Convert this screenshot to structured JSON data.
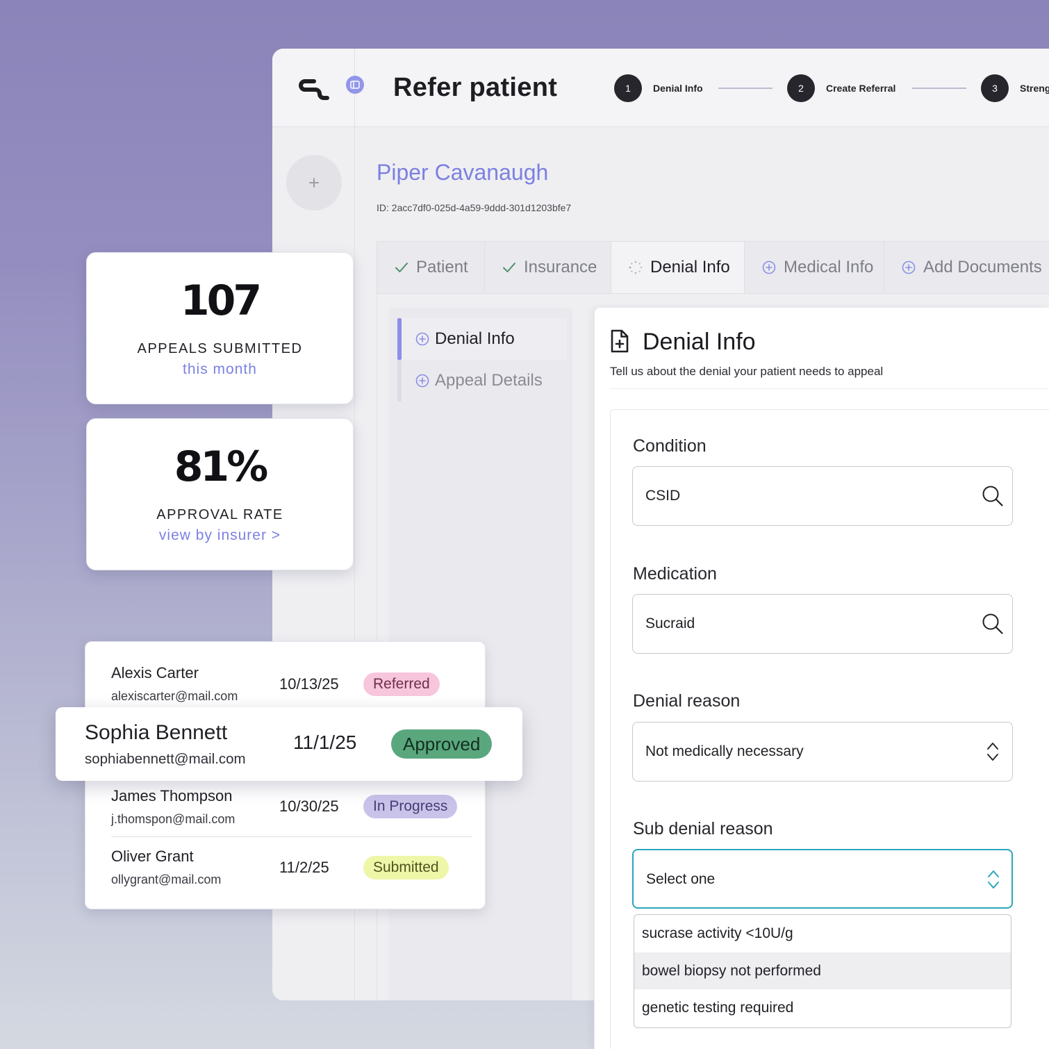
{
  "app": {
    "title": "Refer patient",
    "logo_icon": "brand-logo-icon",
    "sidebar_toggle_icon": "sidebar-toggle-icon",
    "colors": {
      "accent": "#7c80e2",
      "focus": "#2ba6bd",
      "step": "#26262c",
      "check": "#4f8f6c"
    }
  },
  "stepper": [
    {
      "number": "1",
      "label": "Denial Info"
    },
    {
      "number": "2",
      "label": "Create Referral"
    },
    {
      "number": "3",
      "label": "Streng"
    }
  ],
  "patient": {
    "avatar_icon": "plus-icon",
    "name": "Piper Cavanaugh",
    "id": "ID: 2acc7df0-025d-4a59-9ddd-301d1203bfe7"
  },
  "tabs": [
    {
      "label": "Patient",
      "icon": "check-icon",
      "active": false
    },
    {
      "label": "Insurance",
      "icon": "check-icon",
      "active": false
    },
    {
      "label": "Denial Info",
      "icon": "spinner-icon",
      "active": true
    },
    {
      "label": "Medical Info",
      "icon": "plus-circle-icon",
      "active": false
    },
    {
      "label": "Add Documents",
      "icon": "plus-circle-icon",
      "active": false
    }
  ],
  "subnav": [
    {
      "label": "Denial Info",
      "icon": "plus-circle-icon",
      "active": true
    },
    {
      "label": "Appeal Details",
      "icon": "plus-circle-icon",
      "active": false
    }
  ],
  "form": {
    "icon": "document-plus-icon",
    "title": "Denial Info",
    "subtitle": "Tell us about the denial your patient needs to appeal",
    "fields": [
      {
        "label": "Condition",
        "value": "CSID",
        "icon": "search-icon"
      },
      {
        "label": "Medication",
        "value": "Sucraid",
        "icon": "search-icon"
      },
      {
        "label": "Denial reason",
        "value": "Not medically necessary",
        "icon": "chevron-up-down-icon"
      },
      {
        "label": "Sub denial reason",
        "value": "Select one",
        "icon": "chevron-up-down-icon",
        "focused": true
      }
    ],
    "dropdown_options": [
      {
        "label": "sucrase activity <10U/g",
        "highlighted": false
      },
      {
        "label": "bowel biopsy not performed",
        "highlighted": true
      },
      {
        "label": "genetic testing required",
        "highlighted": false
      }
    ]
  },
  "stats": [
    {
      "value": "107",
      "label": "APPEALS SUBMITTED",
      "sublabel": "this month"
    },
    {
      "value": "81%",
      "label": "APPROVAL RATE",
      "sublabel": "view by insurer >"
    }
  ],
  "referrals": [
    {
      "name": "Alexis Carter",
      "email": "alexiscarter@mail.com",
      "date": "10/13/25",
      "status": "Referred",
      "status_bg": "#f8c6dc",
      "status_fg": "#6e2f4b"
    },
    {
      "name": "Sophia Bennett",
      "email": "sophiabennett@mail.com",
      "date": "11/1/25",
      "status": "Approved",
      "status_bg": "#5aa77e",
      "status_fg": "#12301f",
      "highlighted": true
    },
    {
      "name": "James Thompson",
      "email": "j.thomspon@mail.com",
      "date": "10/30/25",
      "status": "In Progress",
      "status_bg": "#c9c3ea",
      "status_fg": "#453d73"
    },
    {
      "name": "Oliver Grant",
      "email": "ollygrant@mail.com",
      "date": "11/2/25",
      "status": "Submitted",
      "status_bg": "#eef6a8",
      "status_fg": "#4f5220"
    }
  ]
}
